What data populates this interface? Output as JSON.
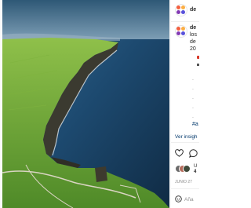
{
  "header": {
    "username": "de"
  },
  "caption": {
    "username": "de",
    "lines": [
      "los",
      "de",
      "20"
    ]
  },
  "dots": [
    ".",
    ".",
    ".",
    ".",
    "."
  ],
  "hashtag": "#a",
  "insights_link": "Ver insigh",
  "likes": {
    "text": "U",
    "count": "4"
  },
  "date": "JUNIO 27",
  "comment": {
    "placeholder": "Aña"
  },
  "colors": {
    "sea": "#1a3c5e",
    "grass": "#6aa83a",
    "cliff": "#3d3a2e",
    "link": "#00376b"
  }
}
